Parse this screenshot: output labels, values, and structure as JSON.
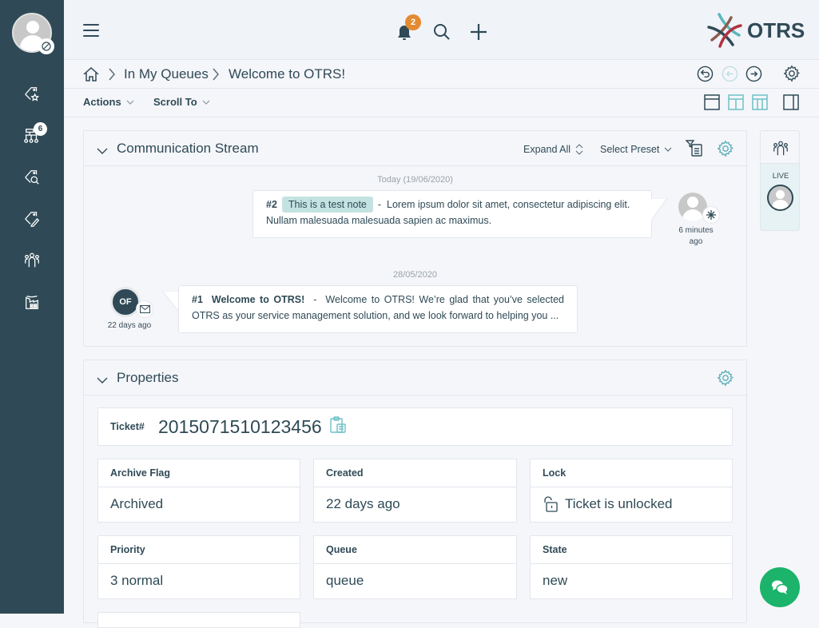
{
  "sidebar": {
    "user_avatar_icon": "user-avatar",
    "items": [
      {
        "icon": "tag-star-icon",
        "label": "Bookmarked tickets"
      },
      {
        "icon": "queue-tree-icon",
        "label": "Queues",
        "badge": "6"
      },
      {
        "icon": "tag-search-icon",
        "label": "Search tickets"
      },
      {
        "icon": "tag-edit-icon",
        "label": "Tickets"
      },
      {
        "icon": "customers-icon",
        "label": "Customers"
      },
      {
        "icon": "factory-icon",
        "label": "Companies"
      }
    ]
  },
  "topbar": {
    "notifications_count": "2",
    "logo_text": "OTRS"
  },
  "breadcrumb": {
    "home_icon": "home-icon",
    "items": [
      "In My Queues",
      "Welcome to OTRS!"
    ]
  },
  "toolbar": {
    "actions_label": "Actions",
    "scroll_to_label": "Scroll To"
  },
  "communication_stream": {
    "title": "Communication Stream",
    "expand_all_label": "Expand All",
    "select_preset_label": "Select Preset",
    "groups": [
      {
        "date": "Today (19/06/2020)",
        "article": {
          "number": "#2",
          "tag": "This is a test note",
          "separator": "-",
          "text": "Lorem ipsum dolor sit amet, consectetur adipiscing elit. Nullam malesuada malesuada sapien ac maximus.",
          "time_line1": "6 minutes",
          "time_line2": "ago"
        }
      },
      {
        "date": "28/05/2020",
        "article": {
          "number": "#1",
          "subject": "Welcome to OTRS!",
          "separator": "-",
          "text": "Welcome to OTRS! We’re glad that you’ve selected OTRS as your service management solution, and we look forward to helping you ...",
          "avatar_initials": "OF",
          "time": "22 days ago"
        }
      }
    ]
  },
  "properties": {
    "title": "Properties",
    "ticket_label": "Ticket#",
    "ticket_number": "2015071510123456",
    "fields": [
      {
        "label": "Archive Flag",
        "value": "Archived"
      },
      {
        "label": "Created",
        "value": "22 days ago"
      },
      {
        "label": "Lock",
        "value": "Ticket is unlocked"
      },
      {
        "label": "Priority",
        "value": "3 normal"
      },
      {
        "label": "Queue",
        "value": "queue"
      },
      {
        "label": "State",
        "value": "new"
      }
    ]
  },
  "right_widget": {
    "live_label": "LIVE"
  },
  "colors": {
    "sidebar_bg": "#2f4a56",
    "accent_teal": "#5aaeb8",
    "badge_orange": "#e38a32",
    "chat_green": "#1cb36b",
    "note_tag_bg": "#c4e2e2"
  }
}
